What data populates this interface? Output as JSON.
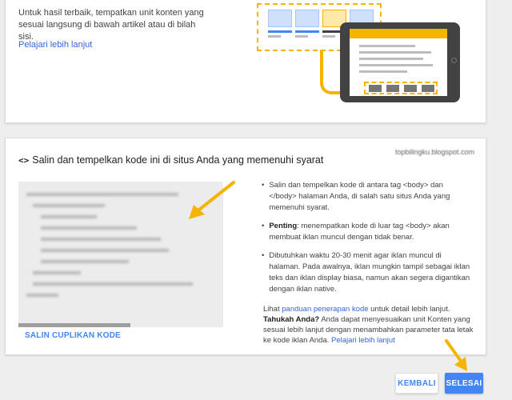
{
  "top_card": {
    "description": "Untuk hasil terbaik, tempatkan unit konten yang sesuai langsung di bawah artikel atau di bilah sisi.",
    "learn_more": "Pelajari lebih lanjut"
  },
  "code_section": {
    "icon": "code-icon",
    "title": "Salin dan tempelkan kode ini di situs Anda yang memenuhi syarat",
    "site_url": "topbilingku.blogspot.com",
    "copy_button": "SALIN CUPLIKAN KODE",
    "bullets": [
      {
        "text": "Salin dan tempelkan kode di antara tag <body> dan </body> halaman Anda, di salah satu situs Anda yang memenuhi syarat."
      },
      {
        "strong": "Penting",
        "text": ": menempatkan kode di luar tag <body> akan membuat iklan muncul dengan tidak benar."
      },
      {
        "text": "Dibutuhkan waktu 20-30 menit agar iklan muncul di halaman. Pada awalnya, iklan mungkin tampil sebagai iklan teks dan iklan display biasa, namun akan segera digantikan dengan iklan native."
      }
    ],
    "info": {
      "prefix": "Lihat ",
      "guide_link": "panduan penerapan kode",
      "suffix": " untuk detail lebih lanjut.",
      "tip_strong": "Tahukah Anda?",
      "tip_text": " Anda dapat menyesuaikan unit Konten yang sesuai lebih lanjut dengan menambahkan parameter tata letak ke kode iklan Anda. ",
      "tip_link": "Pelajari lebih lanjut"
    }
  },
  "footer": {
    "back_button": "KEMBALI",
    "done_button": "SELESAI"
  },
  "colors": {
    "accent": "#4285f4",
    "highlight": "#f4b400",
    "link": "#3367d6"
  }
}
